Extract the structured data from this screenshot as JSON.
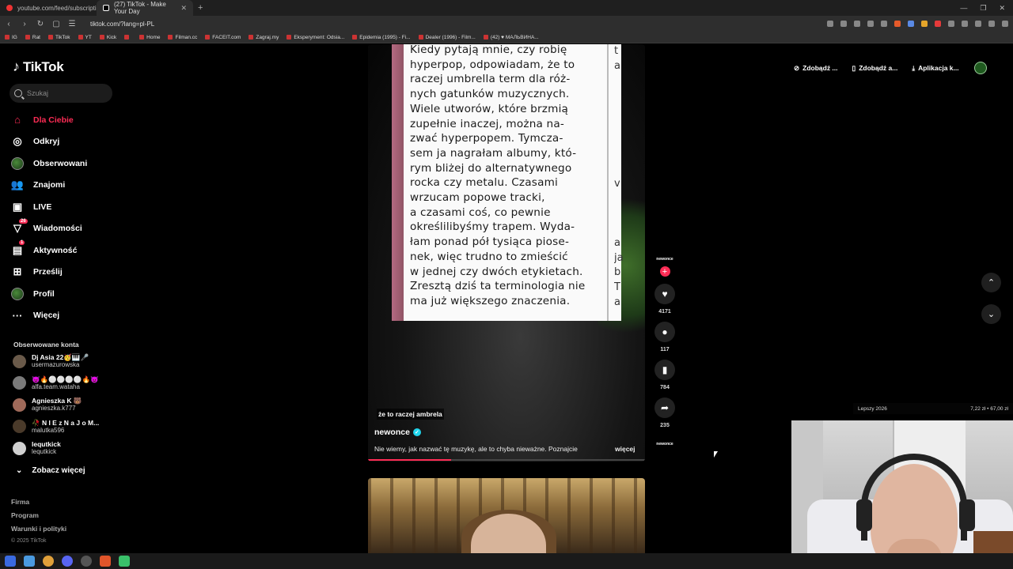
{
  "browser": {
    "tabs": [
      {
        "title": "youtube.com/feed/subscriptions",
        "active": false
      },
      {
        "title": "(27) TikTok - Make Your Day",
        "active": true
      }
    ],
    "new_tab": "+",
    "url": "tiktok.com/?lang=pl-PL",
    "bookmarks": [
      "IG",
      "Rat",
      "TikTok",
      "YT",
      "Kick",
      "",
      "Home",
      "Filman.cc",
      "FACEIT.com",
      "Zagraj.my",
      "Eksperyment: Odsia...",
      "Epidemia (1995) - Fi...",
      "Dealer (1996) - Film...",
      "(42) ♥ МАЛЬВИНА..."
    ]
  },
  "sidebar": {
    "logo": "TikTok",
    "search_placeholder": "Szukaj",
    "nav": [
      {
        "label": "Dla Ciebie",
        "icon": "home-icon",
        "active": true
      },
      {
        "label": "Odkryj",
        "icon": "compass-icon"
      },
      {
        "label": "Obserwowani",
        "icon": "following-avatar-icon"
      },
      {
        "label": "Znajomi",
        "icon": "friends-icon"
      },
      {
        "label": "LIVE",
        "icon": "live-icon"
      },
      {
        "label": "Wiadomości",
        "icon": "messages-icon",
        "badge": "26"
      },
      {
        "label": "Aktywność",
        "icon": "activity-icon",
        "badge": "1"
      },
      {
        "label": "Prześlij",
        "icon": "upload-icon"
      },
      {
        "label": "Profil",
        "icon": "profile-icon"
      },
      {
        "label": "Więcej",
        "icon": "more-icon"
      }
    ],
    "followed_header": "Obserwowane konta",
    "followed": [
      {
        "name": "Dj Asia 22🥳🎹🎤",
        "handle": "usermazurowska"
      },
      {
        "name": "👿🔥⚪⚪⚪⚪🔥👿",
        "handle": "alfa.team.wataha"
      },
      {
        "name": "Agnieszka K 🐻",
        "handle": "agnieszka.k777"
      },
      {
        "name": "🥀 N I E z N a J o M...",
        "handle": "malutka596"
      },
      {
        "name": "lequtkick",
        "handle": "lequtkick"
      }
    ],
    "see_more": "Zobacz więcej",
    "footer": [
      "Firma",
      "Program",
      "Warunki i polityki"
    ],
    "copyright": "© 2025 TikTok"
  },
  "topbar": {
    "buttons": [
      "Zdobądź ...",
      "Zdobądź a...",
      "Aplikacja k..."
    ]
  },
  "video": {
    "paper_lines": [
      "Kiedy pytają mnie, czy robię",
      "hyperpop, odpowiadam, że to",
      "raczej umbrella term dla róż-",
      "nych gatunków muzycznych.",
      "Wiele utworów, które brzmią",
      "zupełnie inaczej, można na-",
      "zwać hyperpopem. Tymcza-",
      "sem ja nagrałam albumy, któ-",
      "rym bliżej do alternatywnego",
      "rocka czy metalu. Czasami",
      "wrzucam popowe tracki,",
      "a czasami coś, co pewnie",
      "określilibyśmy trapem. Wyda-",
      "łam ponad pół tysiąca piose-",
      "nek, więc trudno to zmieścić",
      "w jednej czy dwóch etykietach.",
      "Zresztą dziś ta terminologia nie",
      "ma już większego znaczenia."
    ],
    "paper_col2": [
      "t",
      "a",
      "",
      "",
      "",
      "",
      "",
      "",
      "",
      "v",
      "",
      "",
      "",
      "a",
      "ja",
      "b",
      "T",
      "a"
    ],
    "caption": "że to raczej ambrela",
    "author": "newonce",
    "description": "Nie wiemy, jak nazwać tę muzykę, ale to chyba nieważne. Poznajcie",
    "more": "więcej",
    "progress": 0.3
  },
  "actions": {
    "avatar_label": "newonce",
    "likes": "4171",
    "comments": "117",
    "saves": "784",
    "shares": "235",
    "sound_label": "newonce"
  },
  "overlay": {
    "stream_left": "Lepszy 2026",
    "stream_right": "7,22 zł • 67,00 zł"
  }
}
